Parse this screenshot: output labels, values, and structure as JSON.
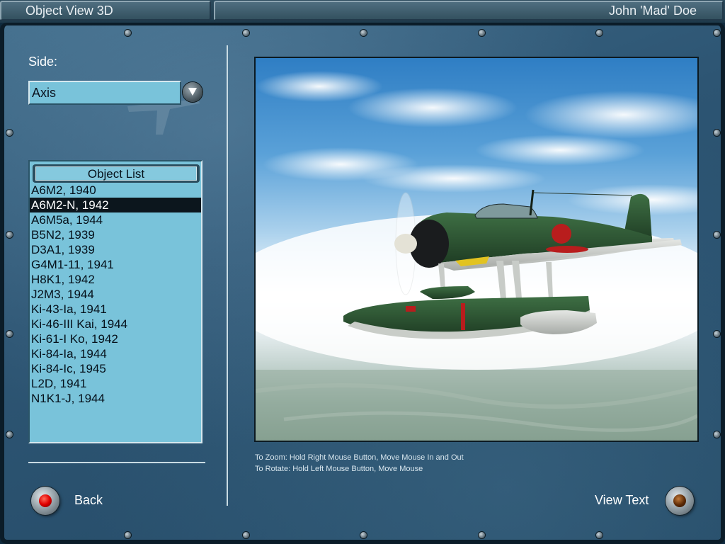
{
  "header": {
    "title": "Object View 3D",
    "user": "John 'Mad' Doe"
  },
  "side": {
    "label": "Side:",
    "value": "Axis"
  },
  "object_list": {
    "header": "Object List",
    "selected_index": 1,
    "items": [
      "A6M2, 1940",
      "A6M2-N, 1942",
      "A6M5a, 1944",
      "B5N2, 1939",
      "D3A1, 1939",
      "G4M1-11, 1941",
      "H8K1, 1942",
      "J2M3, 1944",
      "Ki-43-Ia, 1941",
      "Ki-46-III Kai, 1944",
      "Ki-61-I Ko, 1942",
      "Ki-84-Ia, 1944",
      "Ki-84-Ic, 1945",
      "L2D, 1941",
      "N1K1-J, 1944"
    ]
  },
  "viewer": {
    "hint_zoom": "To Zoom: Hold Right Mouse Button, Move Mouse In and Out",
    "hint_rotate": "To Rotate: Hold Left Mouse Button, Move Mouse"
  },
  "buttons": {
    "back": "Back",
    "view_text": "View Text"
  },
  "icons": {
    "dropdown": "chevron-down-icon",
    "back_lamp": "red-lamp-icon",
    "view_text_lamp": "amber-lamp-icon"
  },
  "colors": {
    "field_bg": "#79c3da",
    "selection_bg": "#0c161d",
    "panel_bg": "#2d5573"
  }
}
